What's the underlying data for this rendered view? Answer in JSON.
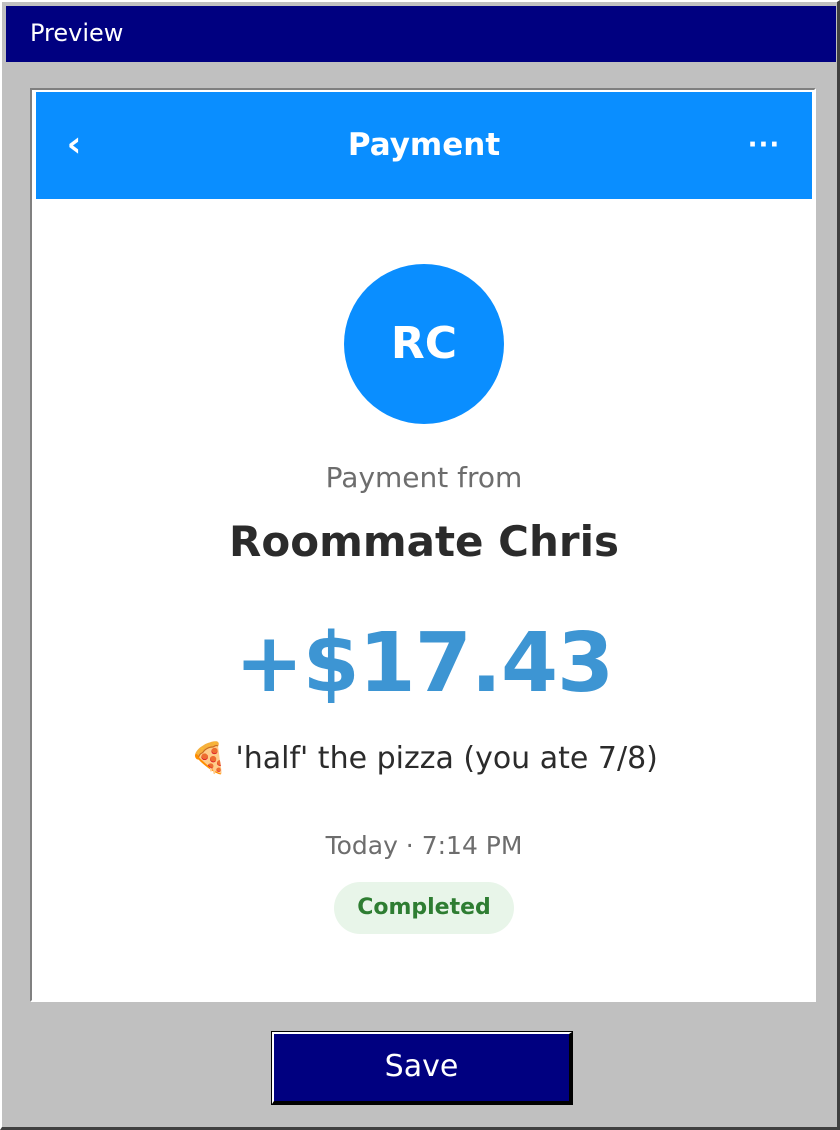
{
  "window": {
    "title": "Preview"
  },
  "appbar": {
    "back_icon": "‹",
    "title": "Payment",
    "more_icon": "···"
  },
  "payment": {
    "avatar_initials": "RC",
    "label": "Payment from",
    "payer_name": "Roommate Chris",
    "amount": "+$17.43",
    "memo_emoji": "🍕",
    "memo_text": "'half' the pizza (you ate 7/8)",
    "timestamp": "Today · 7:14 PM",
    "status": "Completed"
  },
  "footer": {
    "save_label": "Save"
  },
  "colors": {
    "titlebar": "#000080",
    "appbar": "#0a8eff",
    "amount": "#3d95d3",
    "badge_bg": "#e8f5e9",
    "badge_text": "#2e7d32"
  },
  "icons": {
    "back": "chevron-left-icon",
    "more": "more-horizontal-icon",
    "memo": "pizza-icon"
  }
}
